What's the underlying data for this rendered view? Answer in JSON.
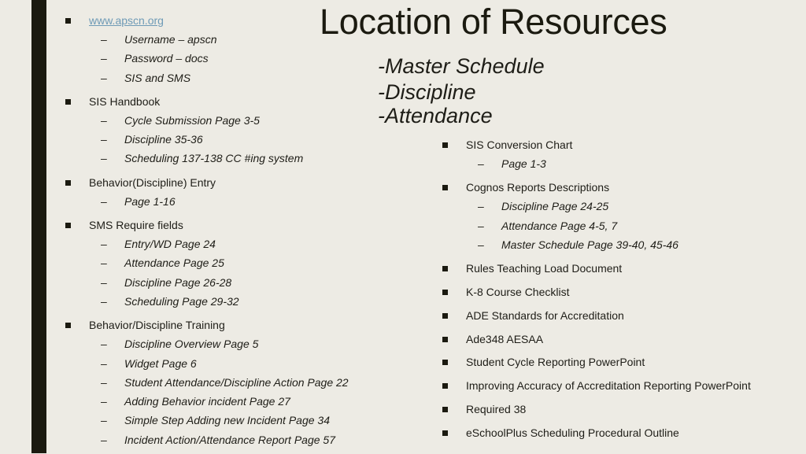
{
  "slide": {
    "title": "Location of Resources",
    "topics": [
      "-Master Schedule",
      "-Discipline",
      "-Attendance"
    ]
  },
  "left_column": [
    {
      "label": "www.apscn.org",
      "is_link": true,
      "sub": [
        "Username – apscn",
        "Password – docs",
        "SIS and SMS"
      ]
    },
    {
      "label": "SIS Handbook",
      "sub": [
        "Cycle Submission Page 3-5",
        "Discipline 35-36",
        "Scheduling 137-138 CC #ing system"
      ]
    },
    {
      "label": "Behavior(Discipline) Entry",
      "sub": [
        "Page 1-16"
      ]
    },
    {
      "label": "SMS Require fields",
      "sub": [
        "Entry/WD Page 24",
        "Attendance Page 25",
        "Discipline Page 26-28",
        "Scheduling Page 29-32"
      ]
    },
    {
      "label": "Behavior/Discipline Training",
      "sub": [
        "Discipline Overview Page 5",
        "Widget Page 6",
        "Student Attendance/Discipline Action Page 22",
        "Adding Behavior incident Page 27",
        "Simple Step Adding new Incident Page 34",
        "Incident Action/Attendance Report Page 57"
      ]
    }
  ],
  "right_column": [
    {
      "label": "SIS Conversion Chart",
      "sub": [
        "Page 1-3"
      ]
    },
    {
      "label": "Cognos Reports Descriptions",
      "sub": [
        "Discipline Page 24-25",
        "Attendance Page 4-5, 7",
        "Master Schedule Page 39-40, 45-46"
      ]
    },
    {
      "label": "Rules Teaching Load Document",
      "sub": []
    },
    {
      "label": "K-8 Course Checklist",
      "sub": []
    },
    {
      "label": "ADE Standards for  Accreditation",
      "sub": []
    },
    {
      "label": "Ade348 AESAA",
      "sub": []
    },
    {
      "label": "Student Cycle Reporting PowerPoint",
      "sub": []
    },
    {
      "label": "Improving Accuracy of Accreditation Reporting PowerPoint",
      "sub": []
    },
    {
      "label": " Required 38",
      "sub": []
    },
    {
      "label": "eSchoolPlus Scheduling Procedural Outline",
      "sub": []
    }
  ],
  "glyphs": {
    "bullet": "square-bullet",
    "dash": "–"
  },
  "colors": {
    "background": "#EDEBE4",
    "accent_bar": "#1B1A10",
    "link": "#6E9AB6",
    "text": "#1E1D17"
  }
}
